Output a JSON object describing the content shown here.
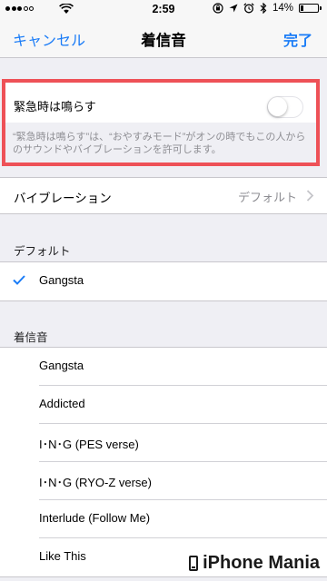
{
  "status_bar": {
    "time": "2:59",
    "battery_pct": "14%",
    "battery_level": 0.14,
    "signal_filled": 3,
    "signal_total": 5,
    "icons": [
      "wifi-icon",
      "orientation-lock-icon",
      "location-icon",
      "alarm-icon",
      "bluetooth-icon",
      "battery-icon"
    ]
  },
  "nav": {
    "left": "キャンセル",
    "title": "着信音",
    "right": "完了"
  },
  "emergency_bypass": {
    "label": "緊急時は鳴らす",
    "enabled": false,
    "footnote": "“緊急時は鳴らす”は、“おやすみモード”がオンの時でもこの人からのサウンドやバイブレーションを許可します。"
  },
  "vibration": {
    "label": "バイブレーション",
    "value": "デフォルト"
  },
  "default_section": {
    "header": "デフォルト",
    "items": [
      {
        "label": "Gangsta",
        "selected": true
      }
    ]
  },
  "ringtones_section": {
    "header": "着信音",
    "items": [
      {
        "label": "Gangsta"
      },
      {
        "label": "Addicted"
      },
      {
        "label": "I･N･G (PES verse)"
      },
      {
        "label": "I･N･G (RYO-Z verse)"
      },
      {
        "label": "Interlude (Follow Me)"
      },
      {
        "label": "Like This"
      }
    ]
  },
  "watermark": "iPhone Mania",
  "colors": {
    "accent": "#1a7cf7",
    "highlight_border": "#ee5157",
    "background": "#efeff4"
  }
}
